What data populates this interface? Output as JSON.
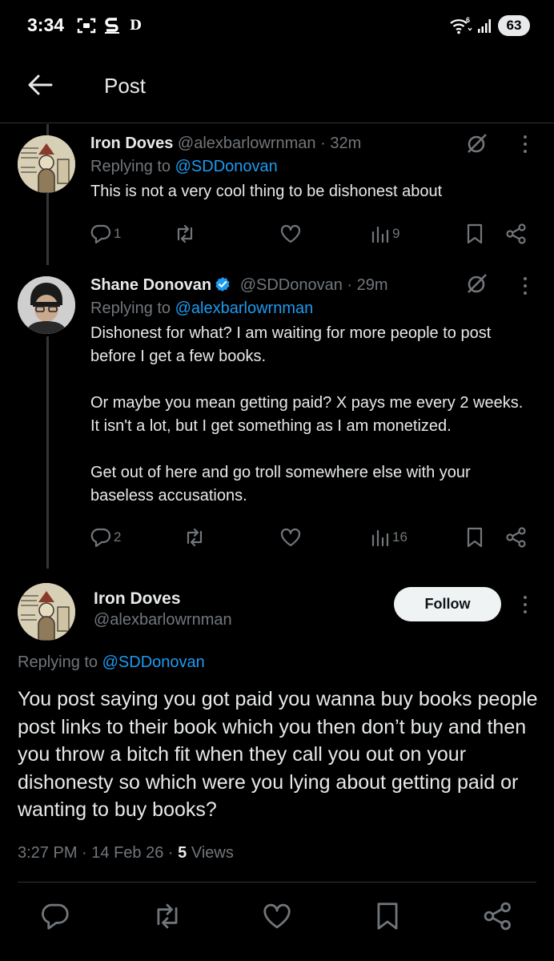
{
  "status_bar": {
    "time": "3:34",
    "d_label": "D",
    "network": "6",
    "battery": "63"
  },
  "header": {
    "title": "Post"
  },
  "replies": [
    {
      "author": "Iron Doves",
      "handle": "@alexbarlowrnman",
      "separator": "·",
      "time": "32m",
      "replying_prefix": "Replying to",
      "replying_to": "@SDDonovan",
      "text": "This is not a very cool thing to be dishonest about",
      "stats": {
        "replies": "1",
        "reposts": "",
        "likes": "",
        "views": "9"
      },
      "verified": false
    },
    {
      "author": "Shane Donovan",
      "handle": "@SDDonovan",
      "separator": "·",
      "time": "29m",
      "replying_prefix": "Replying to",
      "replying_to": "@alexbarlowrnman",
      "text": "Dishonest for what? I am waiting for more people to post before I get a few books.\n\nOr maybe you mean getting paid? X pays me every 2 weeks. It isn't a lot, but I get something as I am monetized.\n\nGet out of here and go troll somewhere else with your baseless accusations.",
      "stats": {
        "replies": "2",
        "reposts": "",
        "likes": "",
        "views": "16"
      },
      "verified": true
    }
  ],
  "main_post": {
    "author": "Iron Doves",
    "handle": "@alexbarlowrnman",
    "follow_label": "Follow",
    "replying_prefix": "Replying to",
    "replying_to": "@SDDonovan",
    "text": "You post saying you got paid you wanna buy books people post links to their book which you then don’t buy and then you throw a bitch fit when they call you out on your dishonesty so which were you lying about getting paid or wanting to buy books?",
    "time": "3:27 PM",
    "date": "14 Feb 26",
    "separator": "·",
    "views_count": "5",
    "views_label": "Views"
  },
  "colors": {
    "accent": "#1d9bf0",
    "muted": "#71767b",
    "text": "#e7e9ea",
    "background": "#000000"
  },
  "icons": [
    "back-arrow-icon",
    "reply-icon",
    "repost-icon",
    "like-icon",
    "views-icon",
    "bookmark-icon",
    "share-icon",
    "grok-icon",
    "more-icon",
    "verified-badge-icon"
  ]
}
